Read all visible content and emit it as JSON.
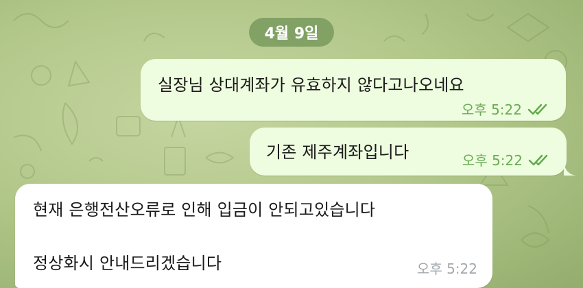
{
  "date_chip": "4월 9일",
  "messages": [
    {
      "direction": "outgoing",
      "text": "실장님 상대계좌가 유효하지 않다고나오네요",
      "time": "오후 5:22",
      "status_icon": "double-check-icon"
    },
    {
      "direction": "outgoing",
      "text": "기존 제주계좌입니다",
      "time": "오후 5:22",
      "status_icon": "double-check-icon"
    },
    {
      "direction": "incoming",
      "lines": [
        "현재 은행전산오류로 인해 입금이 안되고있습니다",
        "정상화시 안내드리겠습니다"
      ],
      "time": "오후 5:22"
    }
  ],
  "colors": {
    "outgoing_bubble": "#eefcdf",
    "incoming_bubble": "#ffffff",
    "outgoing_meta": "#6aab54",
    "incoming_meta": "#a3a8ad",
    "date_chip": "#7aa05c"
  }
}
